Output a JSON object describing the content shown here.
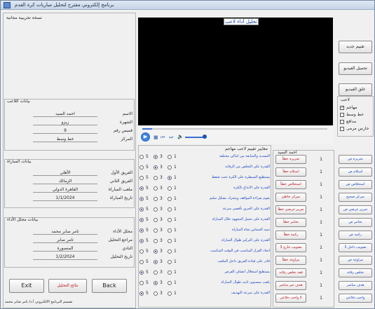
{
  "window": {
    "title": "برنامج إلكتروني مقترح لتحليل مباريات كرة القدم"
  },
  "trial": "نسخة تجريبية مجانية",
  "video": {
    "title": "تحليل أداء لاعب"
  },
  "player": {
    "group": "بيانات اللاعب",
    "fields": [
      {
        "label": "الاسم",
        "value": "احمد السيد"
      },
      {
        "label": "الشهرة",
        "value": "زيزو"
      },
      {
        "label": "قميص رقم",
        "value": "9"
      },
      {
        "label": "المركز",
        "value": "خط وسط"
      }
    ]
  },
  "match": {
    "group": "بيانات المباراة",
    "fields": [
      {
        "label": "الفريق الأول",
        "value": "الأهلي"
      },
      {
        "label": "الفريق الثاني",
        "value": "الزمالك"
      },
      {
        "label": "ملعب المباراة",
        "value": "القاهرة الدولي"
      },
      {
        "label": "تاريخ المباراة",
        "value": "1/1/2024"
      }
    ]
  },
  "analyst": {
    "group": "بيانات محلل الأداء",
    "fields": [
      {
        "label": "محلل الأداء",
        "value": "تامر صابر محمد"
      },
      {
        "label": "مراجع التحليل",
        "value": "تامر صابر"
      },
      {
        "label": "النادي",
        "value": "المنصورة"
      },
      {
        "label": "تاريخ التحليل",
        "value": "1/2/2024"
      }
    ]
  },
  "buttons": {
    "exit": "Exit",
    "results": "نتائج التحليل",
    "back": "Back"
  },
  "footer": "تصميم البرنامج الالكتروني أ.د/ تامر صابر محمد",
  "right_buttons": {
    "new_eval": "تقييم جديد",
    "load_video": "تحميل الفيديو",
    "close_video": "غلق الفيديو"
  },
  "role": {
    "title": "لاعب",
    "options": [
      {
        "label": "مهاجم",
        "checked": true
      },
      {
        "label": "خط وسط",
        "checked": false
      },
      {
        "label": "مدافع",
        "checked": false
      },
      {
        "label": "حارس مرمى",
        "checked": false
      }
    ]
  },
  "criteria": {
    "header": "معايير تقييم لاعب مهاجم",
    "scale": [
      "5",
      "3",
      "1"
    ],
    "items": [
      {
        "text": "التسديد والمتابعة من اماكن مختلفة",
        "sel": "3"
      },
      {
        "text": "القدرة على التخلص من الرقابة",
        "sel": "3"
      },
      {
        "text": "يستطيع السيطرة على الكرة تحت ضغط",
        "sel": "1"
      },
      {
        "text": "القدرة على الابداع بالكرة",
        "sel": "5"
      },
      {
        "text": "يقوم بقراءة المواقف ويتحرك بشكل سليم",
        "sel": "5"
      },
      {
        "text": "القدرة على الجري بأقصى سرعة",
        "sel": "5"
      },
      {
        "text": "القدرة على تحمل المجهود خلال المباراة",
        "sel": "5"
      },
      {
        "text": "تنبيه الحماس تجاه المباراة",
        "sel": "5"
      },
      {
        "text": "القدرة على التركيز طوال المباراة",
        "sel": "5"
      },
      {
        "text": "اتخاذ القرار المناسب في الوقت المناسب",
        "sel": "3"
      },
      {
        "text": "قادر على قيادة الفريق داخل الملعب",
        "sel": "3"
      },
      {
        "text": "يستطيع استغلال انصاف الفرص",
        "sel": "5"
      },
      {
        "text": "يلعب بمستوى ثابت طوال المباراة",
        "sel": "3"
      },
      {
        "text": "القدرة على سرعة التهديف",
        "sel": "5"
      }
    ]
  },
  "events": {
    "header": "احمد السيد",
    "items": [
      {
        "neg": "تجريرة خطأ",
        "count": "1",
        "pos": "تجريرة ص"
      },
      {
        "neg": "استلام خطأ",
        "count": "1",
        "pos": "استلام ص"
      },
      {
        "neg": "استخلاص خطأ",
        "count": "1",
        "pos": "استخلاص ص"
      },
      {
        "neg": "تمركز خاطئ",
        "count": "1",
        "pos": "تمركز صحيح"
      },
      {
        "neg": "تمرير عرضي خطأ",
        "count": "1",
        "pos": "تمرير عرضي ص"
      },
      {
        "neg": "تحامر خطأ",
        "count": "1",
        "pos": "تحامر ص"
      },
      {
        "neg": "ركنية خطأ",
        "count": "1",
        "pos": "ركنية ص"
      },
      {
        "neg": "تصويب خارج 3",
        "count": "1",
        "pos": "تصويب داخل 3"
      },
      {
        "neg": "مراوغة خطأ",
        "count": "1",
        "pos": "مراوغة ص"
      },
      {
        "neg": "فقد تخلص رقابة",
        "count": "1",
        "pos": "تخلص رقابة"
      },
      {
        "neg": "هدف غير مباشر",
        "count": "1",
        "pos": "هدف مباشر"
      },
      {
        "neg": "لا واجب دفاعي",
        "count": "1",
        "pos": "واجب دفاعي"
      }
    ]
  },
  "colors": {
    "neg_text": "#b8121b",
    "pos_text": "#1d46c4",
    "title_text": "#0b3aa8"
  }
}
